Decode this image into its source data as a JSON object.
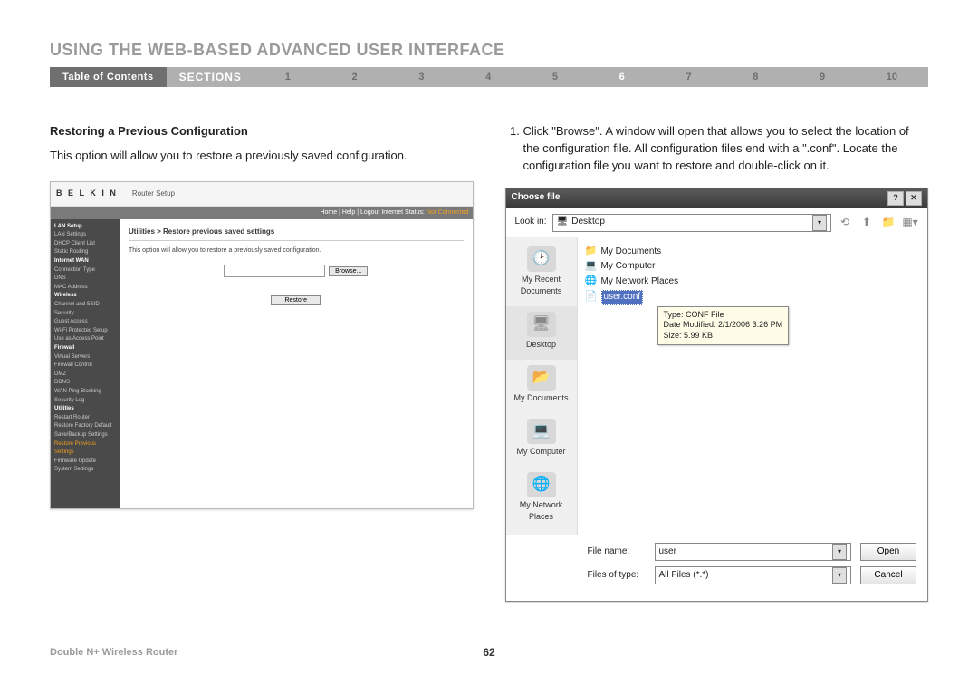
{
  "header": {
    "title": "USING THE WEB-BASED ADVANCED USER INTERFACE"
  },
  "nav": {
    "toc": "Table of Contents",
    "sections_label": "SECTIONS",
    "numbers": [
      "1",
      "2",
      "3",
      "4",
      "5",
      "6",
      "7",
      "8",
      "9",
      "10"
    ],
    "active_index": 5
  },
  "left": {
    "heading": "Restoring a Previous Configuration",
    "body": "This option will allow you to restore a previously saved configuration."
  },
  "right": {
    "step1": "Click \"Browse\". A window will open that allows you to select the location of the configuration file. All configuration files end with a \".conf\". Locate the configuration file you want to restore and double-click on it."
  },
  "router": {
    "brand": "B E L K I N",
    "setup": "Router Setup",
    "status_links": "Home | Help | Logout   Internet Status:",
    "status_value": "Not Connected",
    "crumb": "Utilities > Restore previous saved settings",
    "desc": "This option will allow you to restore a previously saved configuration.",
    "browse_btn": "Browse...",
    "restore_btn": "Restore",
    "menu": {
      "lan_hdr": "LAN Setup",
      "lan1": "LAN Settings",
      "lan2": "DHCP Client List",
      "lan3": "Static Routing",
      "wan_hdr": "Internet WAN",
      "wan1": "Connection Type",
      "wan2": "DNS",
      "wan3": "MAC Address",
      "wl_hdr": "Wireless",
      "wl1": "Channel and SSID",
      "wl2": "Security",
      "wl3": "Guest Access",
      "wl4": "Wi-Fi Protected Setup",
      "wl5": "Use as Access Point",
      "fw_hdr": "Firewall",
      "fw1": "Virtual Servers",
      "fw2": "Firewall Control",
      "fw3": "DMZ",
      "fw4": "DDNS",
      "fw5": "WAN Ping Blocking",
      "fw6": "Security Log",
      "ut_hdr": "Utilities",
      "ut1": "Restart Router",
      "ut2": "Restore Factory Default",
      "ut3": "Save/Backup Settings",
      "ut4": "Restore Previous Settings",
      "ut5": "Firmware Update",
      "ut6": "System Settings"
    }
  },
  "dialog": {
    "title": "Choose file",
    "lookin_label": "Look in:",
    "lookin_value": "Desktop",
    "places": {
      "recent": "My Recent Documents",
      "desktop": "Desktop",
      "mydocs": "My Documents",
      "mycomp": "My Computer",
      "mynet": "My Network Places"
    },
    "files": {
      "f1": "My Documents",
      "f2": "My Computer",
      "f3": "My Network Places",
      "f4": "user.conf"
    },
    "tooltip": {
      "l1": "Type: CONF File",
      "l2": "Date Modified: 2/1/2006 3:26 PM",
      "l3": "Size: 5.99 KB"
    },
    "filename_label": "File name:",
    "filename_value": "user",
    "filetype_label": "Files of type:",
    "filetype_value": "All Files (*.*)",
    "open_btn": "Open",
    "cancel_btn": "Cancel"
  },
  "footer": {
    "product": "Double N+ Wireless Router",
    "page": "62"
  }
}
